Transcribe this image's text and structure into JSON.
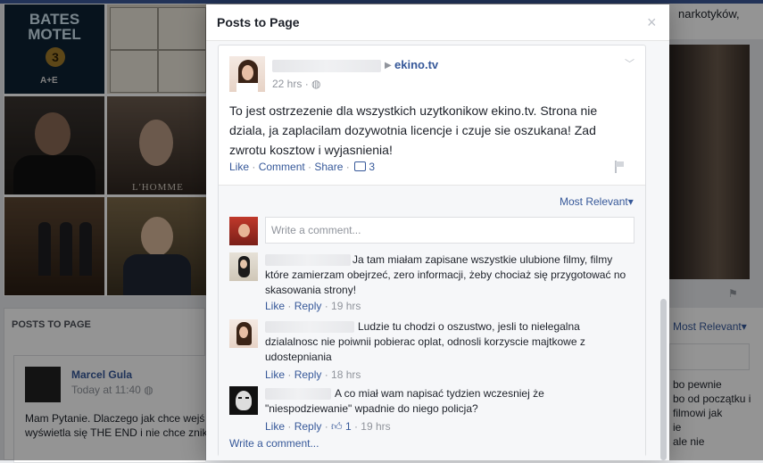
{
  "background": {
    "right_top_text": "narkotyków,",
    "grid_thumbs": {
      "bates_line1": "BATES",
      "bates_line2": "MOTEL",
      "bates_number": "3",
      "network": "A+E",
      "homme_text": "L'HOMME"
    },
    "posts_header": "POSTS TO PAGE",
    "bg_post": {
      "author": "Marcel Gula",
      "time": "Today at 11:40",
      "text_line1": "Mam Pytanie. Dlaczego jak chce wejś",
      "text_line2": "wyświetla się THE END i nie chce znik"
    },
    "right_box": {
      "most_relevant": "Most Relevant",
      "text_lines": [
        "bo pewnie",
        "bo od początku i",
        "filmowi jak",
        "ie",
        "ale nie"
      ]
    }
  },
  "dialog": {
    "title": "Posts to Page",
    "close_glyph": "×",
    "post": {
      "page_name": "ekino.tv",
      "time": "22 hrs",
      "text": "To jest ostrzezenie dla wszystkich uzytkonikow ekino.tv. Strona nie dziala, ja zaplacilam dozywotnia licencje i czuje sie oszukana! Zad zwrotu kosztow i wyjasnienia!",
      "actions": {
        "like": "Like",
        "comment": "Comment",
        "share": "Share",
        "comment_count": "3"
      }
    },
    "comments": {
      "sort_label": "Most Relevant",
      "input_placeholder": "Write a comment...",
      "items": [
        {
          "text": "Ja tam miałam zapisane wszystkie ulubione filmy, filmy które zamierzam obejrzeć, zero informacji, żeby chociaż się przygotować no skasowania strony!",
          "like": "Like",
          "reply": "Reply",
          "time": "19 hrs"
        },
        {
          "text": "Ludzie tu chodzi o oszustwo, jesli to nielegalna dzialalnosc nie poiwnii pobierac oplat, odnosli korzyscie majtkowe z udostepniania",
          "like": "Like",
          "reply": "Reply",
          "time": "18 hrs"
        },
        {
          "text": "A co miał wam napisać tydzien wczesniej że \"niespodziewanie\" wpadnie do niego policja?",
          "like": "Like",
          "reply": "Reply",
          "likes": "1",
          "time": "19 hrs"
        }
      ],
      "write_comment": "Write a comment..."
    }
  }
}
